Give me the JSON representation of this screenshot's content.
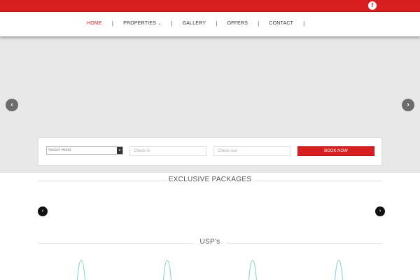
{
  "social": {
    "facebook_label": "f"
  },
  "nav": {
    "items": [
      {
        "label": "HOME",
        "active": true
      },
      {
        "label": "PROPERTIES",
        "has_dropdown": true
      },
      {
        "label": "GALLERY"
      },
      {
        "label": "OFFERS"
      },
      {
        "label": "CONTACT"
      }
    ],
    "separator": "|"
  },
  "hero": {
    "prev_icon": "‹",
    "next_icon": "›"
  },
  "booking": {
    "hotel_select": "Select Hotel",
    "checkin_placeholder": "Check-in",
    "checkout_placeholder": "Check-out",
    "book_label": "BOOK NOW"
  },
  "packages": {
    "title": "EXCLUSIVE PACKAGES",
    "prev_icon": "‹",
    "next_icon": "›"
  },
  "usps": {
    "title": "USP's"
  },
  "colors": {
    "accent": "#d71f1f",
    "hero_bg": "#e8e8e8",
    "usp_icon": "#7fd3c6"
  }
}
